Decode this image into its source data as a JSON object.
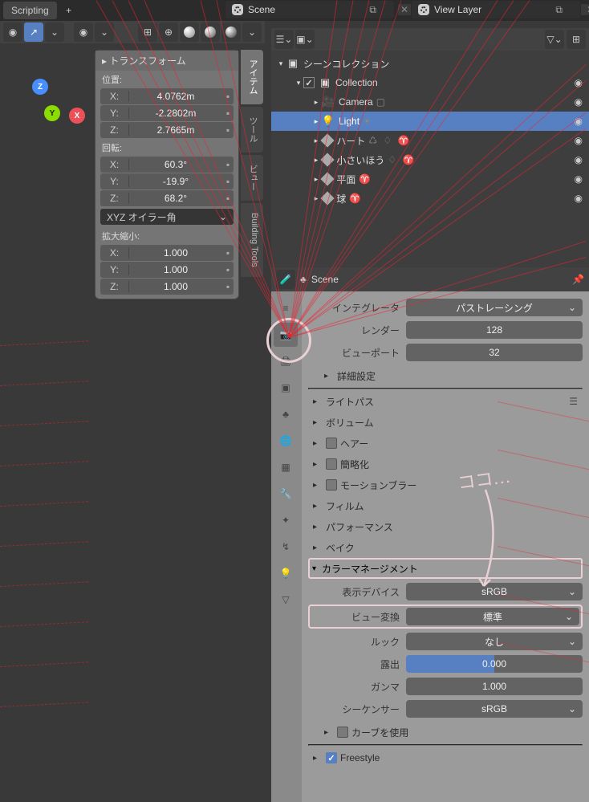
{
  "topbar": {
    "tab": "Scripting",
    "scene_label": "Scene",
    "viewlayer_label": "View Layer"
  },
  "npanel": {
    "title": "トランスフォーム",
    "loc_label": "位置:",
    "rot_label": "回転:",
    "scale_label": "拡大縮小:",
    "loc": {
      "x": "4.0762m",
      "y": "-2.2802m",
      "z": "2.7665m"
    },
    "rot": {
      "x": "60.3°",
      "y": "-19.9°",
      "z": "68.2°"
    },
    "rotmode": "XYZ オイラー角",
    "scale": {
      "x": "1.000",
      "y": "1.000",
      "z": "1.000"
    },
    "tabs": [
      "アイテム",
      "ツール",
      "ビュー",
      "Building Tools"
    ]
  },
  "outliner": {
    "root": "シーンコレクション",
    "coll": "Collection",
    "items": [
      {
        "name": "Camera"
      },
      {
        "name": "Light"
      },
      {
        "name": "ハート"
      },
      {
        "name": "小さいほう"
      },
      {
        "name": "平面"
      },
      {
        "name": "球"
      }
    ]
  },
  "props": {
    "context": "Scene",
    "integrator_label": "インテグレータ",
    "integrator": "パストレーシング",
    "render_label": "レンダー",
    "render": "128",
    "viewport_label": "ビューポート",
    "viewport": "32",
    "panels": {
      "advanced": "詳細設定",
      "lightpaths": "ライトパス",
      "volume": "ボリューム",
      "hair": "ヘアー",
      "simplify": "簡略化",
      "mblur": "モーションブラー",
      "film": "フィルム",
      "perf": "パフォーマンス",
      "bake": "ベイク",
      "cm": "カラーマネージメント"
    },
    "cm": {
      "device_label": "表示デバイス",
      "device": "sRGB",
      "view_label": "ビュー変換",
      "view": "標準",
      "look_label": "ルック",
      "look": "なし",
      "exposure_label": "露出",
      "exposure": "0.000",
      "gamma_label": "ガンマ",
      "gamma": "1.000",
      "seq_label": "シーケンサー",
      "seq": "sRGB",
      "curves": "カーブを使用",
      "freestyle": "Freestyle"
    }
  },
  "annotation": "ココ…"
}
